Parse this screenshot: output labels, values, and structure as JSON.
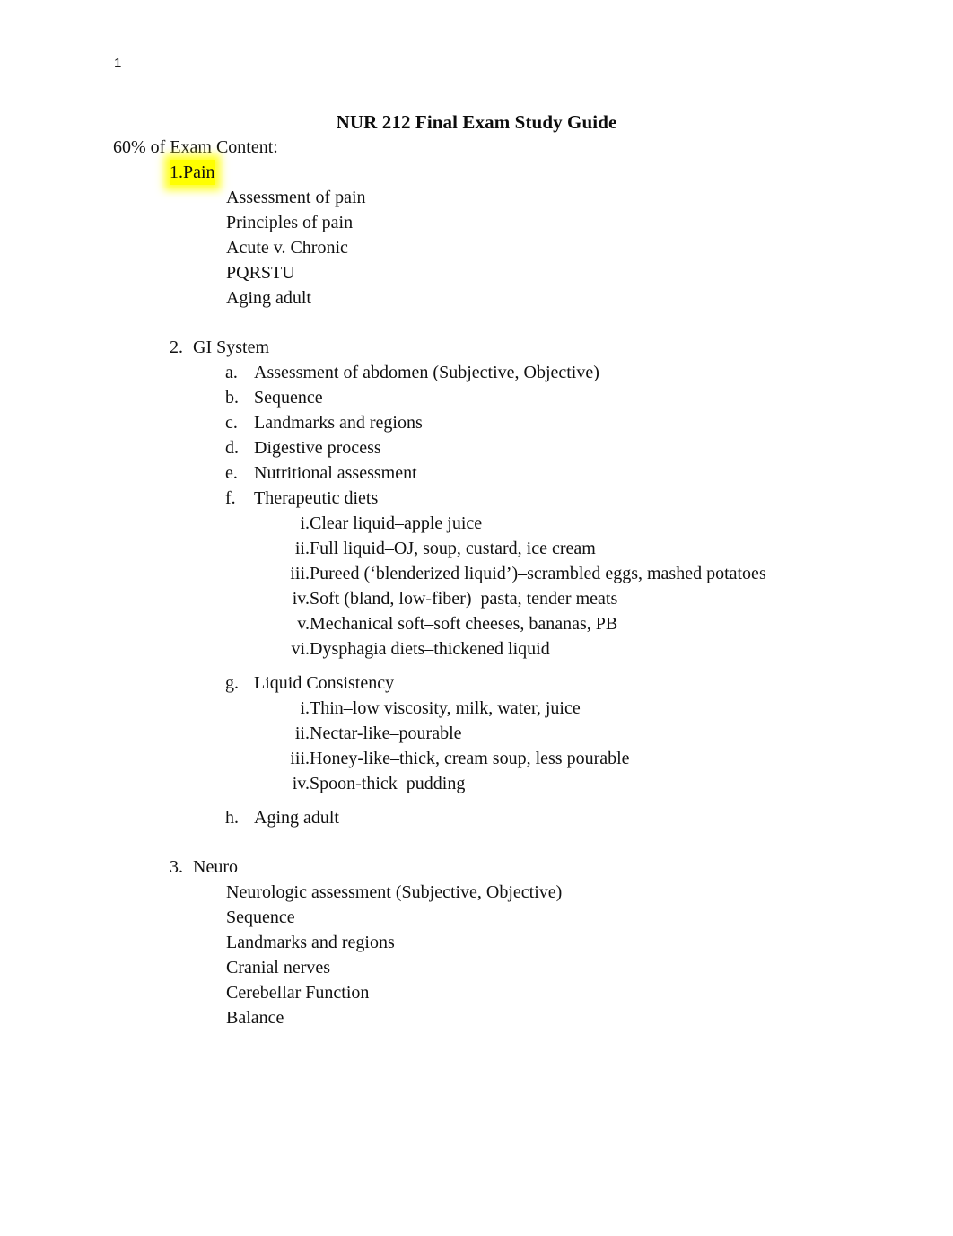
{
  "document": {
    "page_number": "1",
    "title": "NUR 212 Final Exam Study Guide",
    "intro": "60% of Exam Content:",
    "highlight_color": "#ffff00"
  },
  "sections": [
    {
      "marker": "1.",
      "title": "Pain",
      "highlighted": true,
      "plain_items": [
        "Assessment of pain",
        "Principles of pain",
        "Acute v. Chronic",
        "PQRSTU",
        "Aging adult"
      ]
    },
    {
      "marker": "2.",
      "title": "GI System",
      "highlighted": false,
      "alpha_items": [
        {
          "marker": "a.",
          "text": "Assessment of abdomen (Subjective, Objective)"
        },
        {
          "marker": "b.",
          "text": "Sequence"
        },
        {
          "marker": "c.",
          "text": "Landmarks and regions"
        },
        {
          "marker": "d.",
          "text": "Digestive process"
        },
        {
          "marker": "e.",
          "text": "Nutritional assessment"
        },
        {
          "marker": "f.",
          "text": "Therapeutic diets"
        }
      ],
      "diet_romans": [
        {
          "marker": "i.",
          "text": "Clear liquid–apple juice"
        },
        {
          "marker": "ii.",
          "text": "Full liquid–OJ, soup, custard, ice cream"
        },
        {
          "marker": "iii.",
          "text": "Pureed (‘blenderized liquid’)–scrambled eggs, mashed potatoes"
        },
        {
          "marker": "iv.",
          "text": "Soft (bland, low-fiber)–pasta, tender meats"
        },
        {
          "marker": "v.",
          "text": "Mechanical soft–soft cheeses, bananas, PB"
        },
        {
          "marker": "vi.",
          "text": "Dysphagia diets–thickened liquid"
        }
      ],
      "consistency_heading": {
        "marker": "g.",
        "text": "Liquid Consistency"
      },
      "consistency_romans": [
        {
          "marker": "i.",
          "text": "Thin–low viscosity, milk, water, juice"
        },
        {
          "marker": "ii.",
          "text": "Nectar-like–pourable"
        },
        {
          "marker": "iii.",
          "text": "Honey-like–thick, cream soup, less pourable"
        },
        {
          "marker": "iv.",
          "text": "Spoon-thick–pudding"
        }
      ],
      "final_alpha": {
        "marker": "h.",
        "text": "Aging adult"
      }
    },
    {
      "marker": "3.",
      "title": "Neuro",
      "highlighted": false,
      "plain_items": [
        "Neurologic assessment (Subjective, Objective)",
        "Sequence",
        "Landmarks and regions",
        "Cranial nerves",
        "Cerebellar Function",
        "Balance"
      ]
    }
  ]
}
